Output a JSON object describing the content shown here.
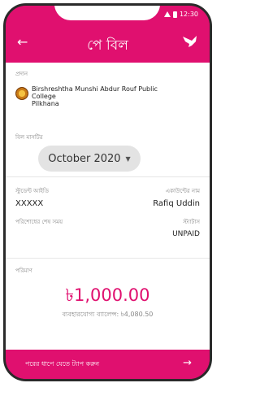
{
  "appbar": {
    "title": "পে বিল",
    "back_icon": "arrow-back-icon",
    "brand_icon": "bird-icon"
  },
  "status_bar": {
    "time": "12:30"
  },
  "biller": {
    "label": "প্রদান",
    "name": "Birshreshtha Munshi Abdur Rouf Public College",
    "sub": "Pilkhana"
  },
  "bill_month": {
    "label": "বিল মাসটির",
    "value": "October 2020"
  },
  "student": {
    "id_label": "স্টুডেন্ট আইডি",
    "id_value": "XXXXX",
    "name_label": "একাউন্টের নাম",
    "name_value": "Rafiq Uddin"
  },
  "payment": {
    "due_label": "পরিশোধের শেষ সময়",
    "status_label": "স্ট্যাটাস",
    "status_value": "UNPAID"
  },
  "amount": {
    "label": "পরিমাণ",
    "value": "৳1,000.00",
    "available": "ব্যবহারযোগ্য ব্যালেন্স: ৳4,080.50"
  },
  "footer": {
    "cta_label": "পরের ধাপে যেতে ট্যাপ করুন",
    "arrow_icon": "arrow-forward-icon"
  },
  "colors": {
    "brand": "#e0106f",
    "background": "#ffffff",
    "select_bg": "#e3e3e3"
  }
}
